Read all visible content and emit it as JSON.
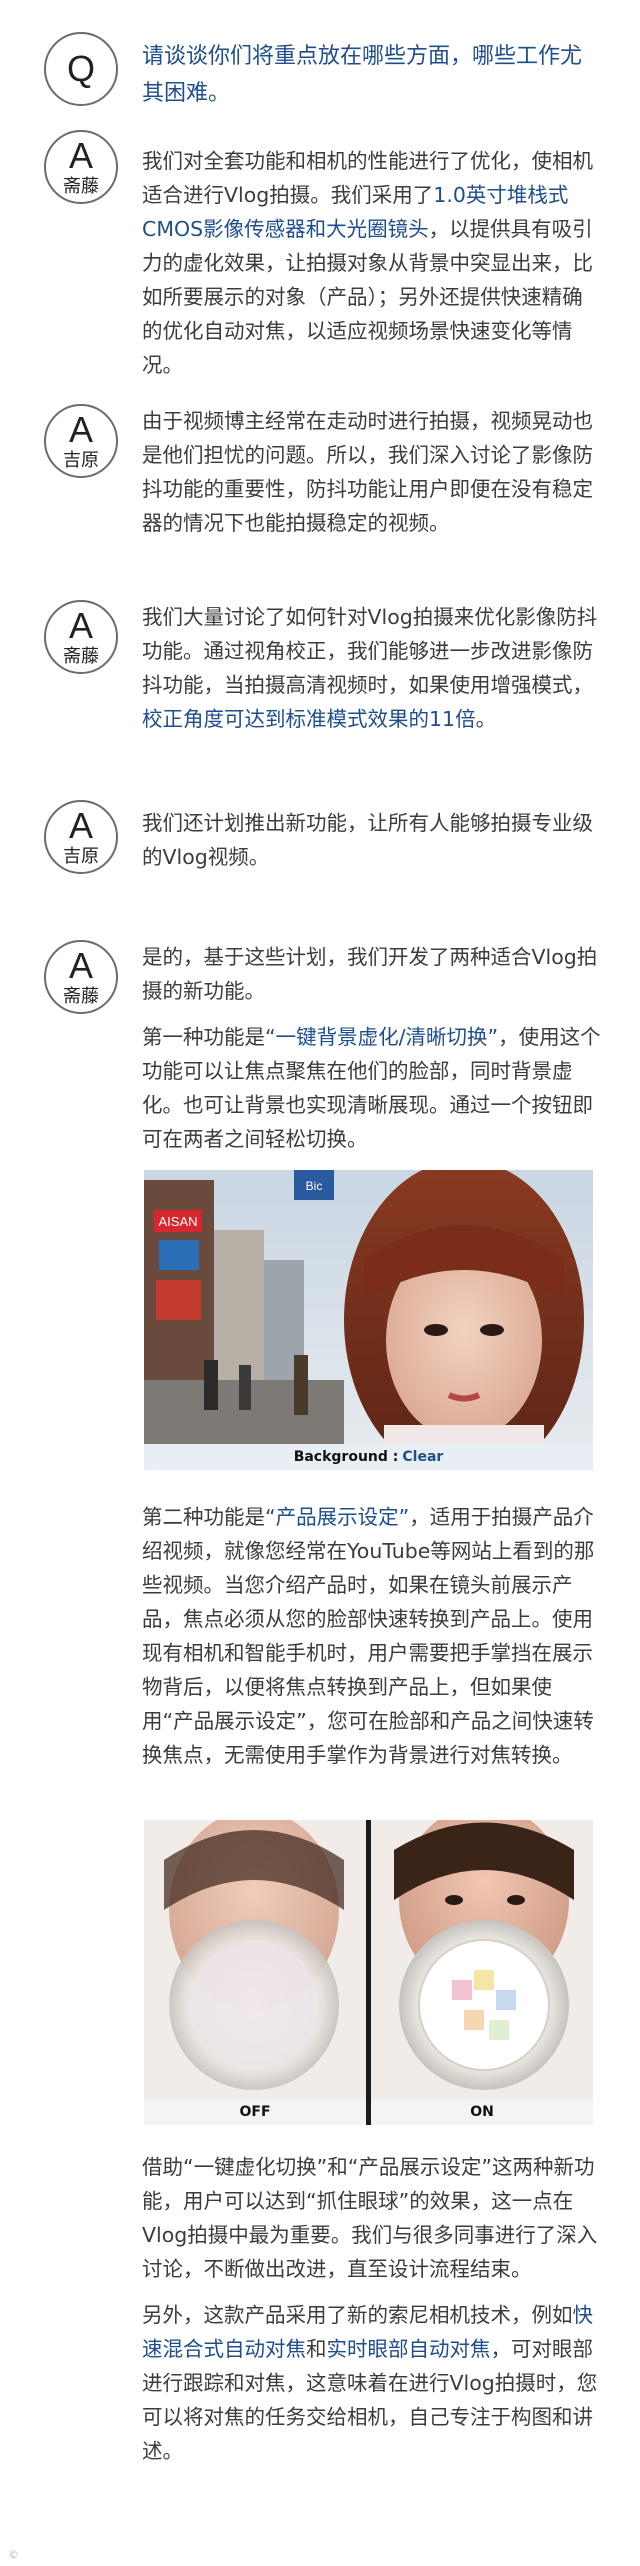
{
  "q": {
    "letter": "Q",
    "text": "请谈谈你们将重点放在哪些方面，哪些工作尤其困难。"
  },
  "a1": {
    "letter": "A",
    "name": "斋藤",
    "t1": "我们对全套功能和相机的性能进行了优化，使相机适合进行Vlog拍摄。我们采用了",
    "h1": "1.0英寸堆栈式CMOS影像传感器和大光圈镜头",
    "t2": "，以提供具有吸引力的虚化效果，让拍摄对象从背景中突显出来，比如所要展示的对象（产品）；另外还提供快速精确的优化自动对焦，以适应视频场景快速变化等情况。"
  },
  "a2": {
    "letter": "A",
    "name": "吉原",
    "text": "由于视频博主经常在走动时进行拍摄，视频晃动也是他们担忧的问题。所以，我们深入讨论了影像防抖功能的重要性，防抖功能让用户即便在没有稳定器的情况下也能拍摄稳定的视频。"
  },
  "a3": {
    "letter": "A",
    "name": "斋藤",
    "t1": "我们大量讨论了如何针对Vlog拍摄来优化影像防抖功能。通过视角校正，我们能够进一步改进影像防抖功能，当拍摄高清视频时，如果使用增强模式，",
    "h1": "校正角度可达到标准模式效果的11倍",
    "t2": "。"
  },
  "a4": {
    "letter": "A",
    "name": "吉原",
    "text": "我们还计划推出新功能，让所有人能够拍摄专业级的Vlog视频。"
  },
  "a5": {
    "letter": "A",
    "name": "斋藤",
    "p1": "是的，基于这些计划，我们开发了两种适合Vlog拍摄的新功能。",
    "p2a": "第一种功能是",
    "p2h": "“一键背景虚化/清晰切换”",
    "p2b": "，使用这个功能可以让焦点聚焦在他们的脸部，同时背景虚化。也可让背景也实现清晰展现。通过一个按钮即可在两者之间轻松切换。",
    "p3a": "第二种功能是",
    "p3h": "“产品展示设定”",
    "p3b": "，适用于拍摄产品介绍视频，就像您经常在YouTube等网站上看到的那些视频。当您介绍产品时，如果在镜头前展示产品，焦点必须从您的脸部快速转换到产品上。使用现有相机和智能手机时，用户需要把手掌挡在展示物背后，以便将焦点转换到产品上，但如果使用“产品展示设定”，您可在脸部和产品之间快速转换焦点，无需使用手掌作为背景进行对焦转换。",
    "p4": "借助“一键虚化切换”和“产品展示设定”这两种新功能，用户可以达到“抓住眼球”的效果，这一点在Vlog拍摄中最为重要。我们与很多同事进行了深入讨论，不断做出改进，直至设计流程结束。",
    "p5a": "另外，这款产品采用了新的索尼相机技术，例如",
    "p5h1": "快速混合式自动对焦",
    "p5m": "和",
    "p5h2": "实时眼部自动对焦",
    "p5b": "，可对眼部进行跟踪和对焦，这意味着在进行Vlog拍摄时，您可以将对焦的任务交给相机，自己专注于构图和讲述。"
  },
  "photo1": {
    "caption_label": "Background :",
    "caption_value": "Clear",
    "signs": [
      "AISAN",
      "Bic"
    ]
  },
  "photo2": {
    "left_label": "OFF",
    "right_label": "ON"
  },
  "footer": {
    "mark": "©"
  }
}
